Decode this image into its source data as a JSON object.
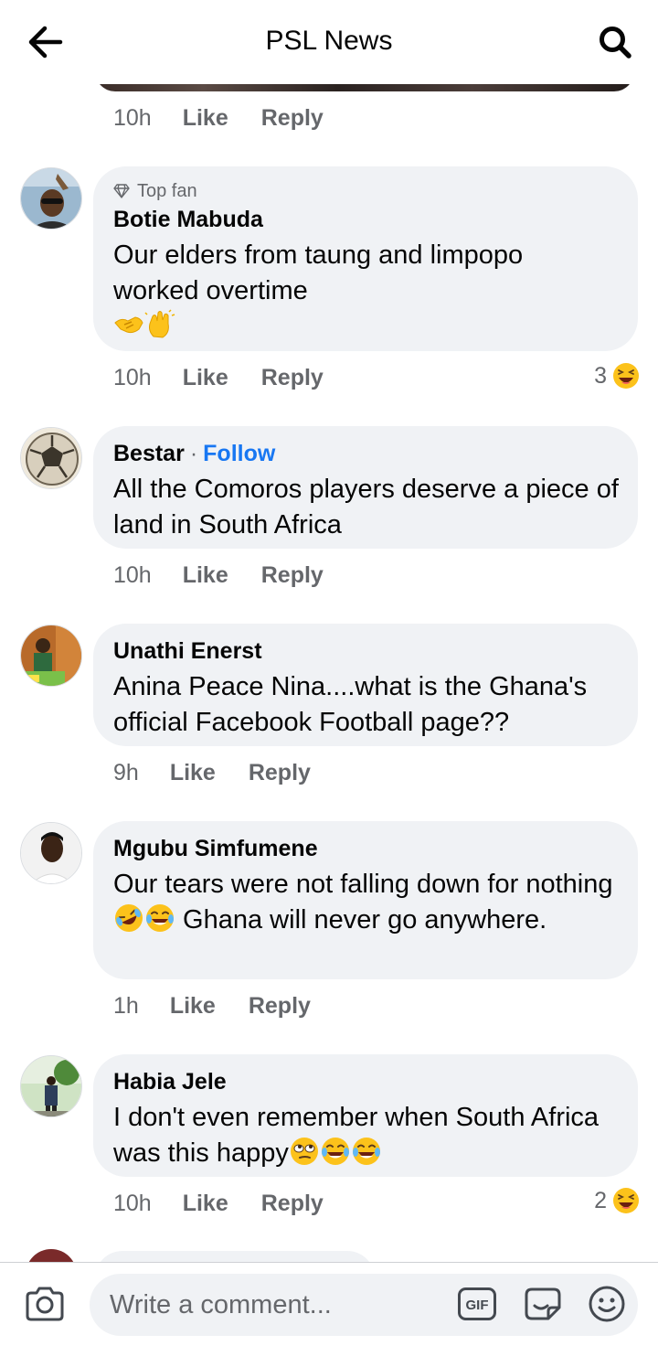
{
  "header": {
    "title": "PSL News",
    "back_icon": "arrow-left-icon",
    "search_icon": "search-icon"
  },
  "top_meta": {
    "time": "10h",
    "like": "Like",
    "reply": "Reply"
  },
  "comments": [
    {
      "badge": "Top fan",
      "badge_icon": "diamond-icon",
      "name": "Botie Mabuda",
      "text": "Our elders from taung and limpopo worked overtime",
      "emojis": [
        "handshake-emoji",
        "clapping-hands-emoji"
      ],
      "time": "10h",
      "like": "Like",
      "reply": "Reply",
      "reaction_count": "3",
      "reaction_icon": "laughing-emoji"
    },
    {
      "name": "Bestar",
      "follow": "Follow",
      "text": "All the Comoros players deserve a piece of land in South Africa",
      "time": "10h",
      "like": "Like",
      "reply": "Reply"
    },
    {
      "name": "Unathi Enerst",
      "text": "Anina Peace Nina....what is the Ghana's official Facebook Football page??",
      "time": "9h",
      "like": "Like",
      "reply": "Reply"
    },
    {
      "name": "Mgubu Simfumene",
      "text_a": "Our tears were not falling down for nothing",
      "text_b": " Ghana will never go anywhere.",
      "emojis": [
        "rolling-laughing-emoji",
        "tears-of-joy-emoji"
      ],
      "time": "1h",
      "like": "Like",
      "reply": "Reply"
    },
    {
      "name": "Habia Jele",
      "text": "I don't even remember when South Africa was this happy",
      "emojis": [
        "rolling-eyes-emoji",
        "tears-of-joy-emoji",
        "tears-of-joy-emoji"
      ],
      "time": "10h",
      "like": "Like",
      "reply": "Reply",
      "reaction_count": "2",
      "reaction_icon": "laughing-emoji"
    }
  ],
  "composer": {
    "placeholder": "Write a comment...",
    "camera_icon": "camera-icon",
    "gif_icon": "gif-icon",
    "sticker_icon": "sticker-icon",
    "emoji_icon": "smiley-icon"
  },
  "colors": {
    "accent": "#1877f2",
    "bubble": "#f0f2f5",
    "secondary_text": "#65676b",
    "emoji_yellow": "#fcc21b"
  }
}
